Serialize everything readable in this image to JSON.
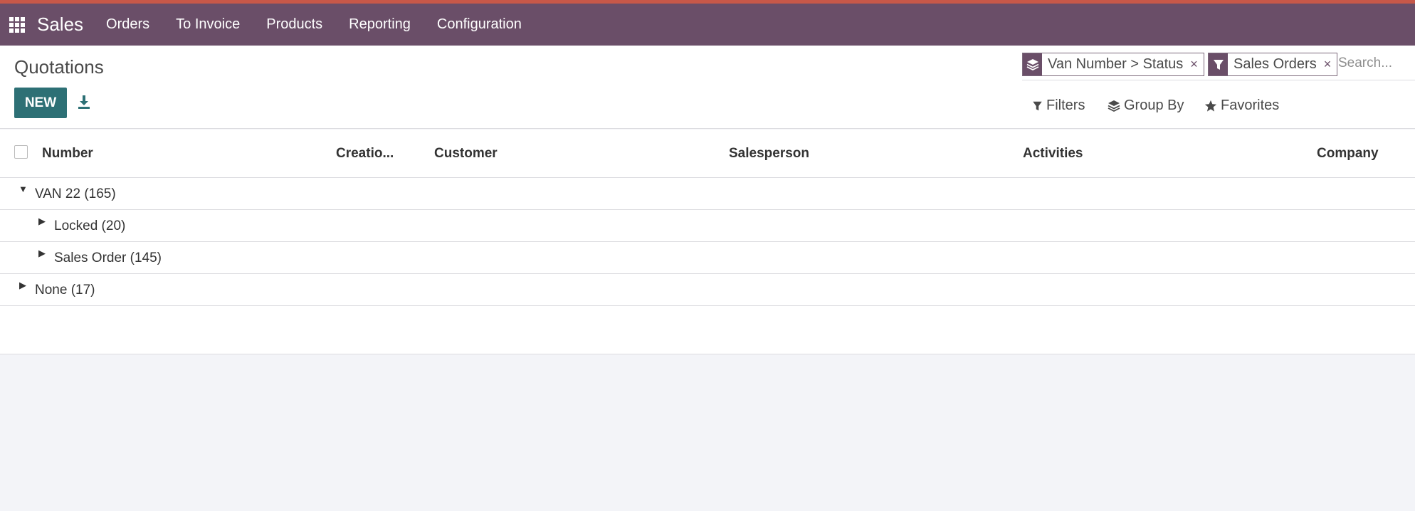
{
  "navbar": {
    "app_name": "Sales",
    "menu": [
      "Orders",
      "To Invoice",
      "Products",
      "Reporting",
      "Configuration"
    ]
  },
  "page": {
    "title": "Quotations",
    "new_label": "NEW"
  },
  "search": {
    "facets": [
      {
        "icon": "layers-icon",
        "label": "Van Number > Status"
      },
      {
        "icon": "filter-icon",
        "label": "Sales Orders"
      }
    ],
    "placeholder": "Search...",
    "filters_label": "Filters",
    "groupby_label": "Group By",
    "favorites_label": "Favorites"
  },
  "table": {
    "columns": [
      "Number",
      "Creatio...",
      "Customer",
      "Salesperson",
      "Activities",
      "Company"
    ],
    "groups": [
      {
        "label": "VAN 22 (165)",
        "expanded": true,
        "level": 0
      },
      {
        "label": "Locked (20)",
        "expanded": false,
        "level": 1
      },
      {
        "label": "Sales Order (145)",
        "expanded": false,
        "level": 1
      },
      {
        "label": "None (17)",
        "expanded": false,
        "level": 0
      }
    ]
  },
  "colors": {
    "navbar": "#6a4e68",
    "navbar_top_border": "#c75849",
    "primary_button": "#2d7075",
    "background": "#f3f4f8"
  }
}
